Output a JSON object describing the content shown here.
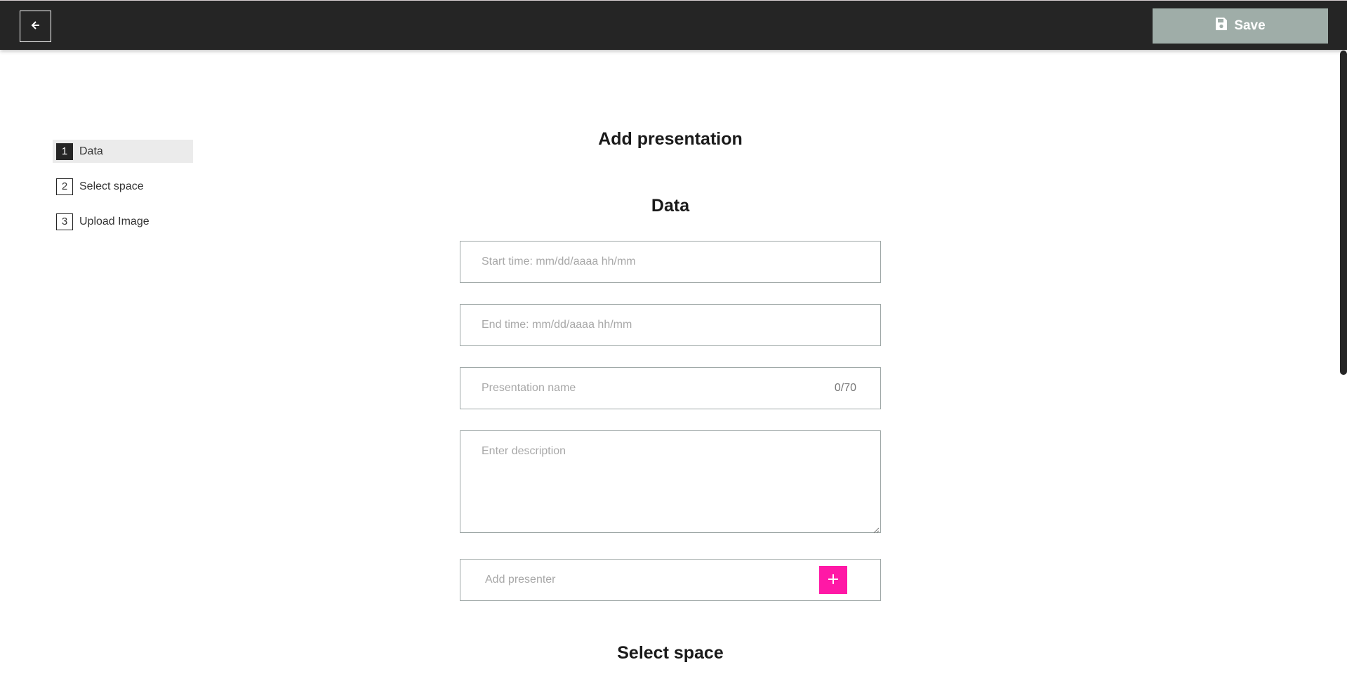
{
  "header": {
    "back_icon": "arrow-left-icon",
    "save_icon": "floppy-disk-icon",
    "save_label": "Save",
    "save_color": "#9fada8",
    "bar_color": "#252525"
  },
  "steps": [
    {
      "number": "1",
      "label": "Data",
      "active": true
    },
    {
      "number": "2",
      "label": "Select space",
      "active": false
    },
    {
      "number": "3",
      "label": "Upload Image",
      "active": false
    }
  ],
  "main": {
    "title": "Add presentation",
    "data_section_title": "Data",
    "start_time": {
      "value": "",
      "placeholder": "Start time: mm/dd/aaaa hh/mm"
    },
    "end_time": {
      "value": "",
      "placeholder": "End time: mm/dd/aaaa hh/mm"
    },
    "presentation_name": {
      "value": "",
      "placeholder": "Presentation name",
      "counter": "0/70"
    },
    "description": {
      "value": "",
      "placeholder": "Enter description"
    },
    "presenter": {
      "value": "",
      "placeholder": "Add presenter",
      "add_icon": "plus-icon",
      "add_color": "#ff18a6"
    },
    "select_space_title": "Select space"
  }
}
